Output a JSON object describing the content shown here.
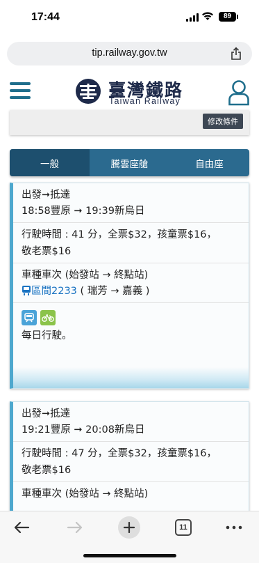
{
  "status": {
    "time": "17:44",
    "battery": "89"
  },
  "browser": {
    "url": "tip.railway.gov.tw",
    "tab_count": "11"
  },
  "header": {
    "title": "臺灣鐵路",
    "subtitle": "Taiwan Railway"
  },
  "condition": {
    "modify_label": "修改條件"
  },
  "tabs": [
    {
      "label": "一般",
      "active": true
    },
    {
      "label": "騰雲座艙",
      "active": false
    },
    {
      "label": "自由座",
      "active": false
    }
  ],
  "trains": [
    {
      "route_header": "出發➞抵達",
      "route": "18:58豐原 ➞ 19:39新烏日",
      "fare_line1": "行駛時間 : 41 分，全票$32，孩童票$16，",
      "fare_line2": "敬老票$16",
      "type_header": "車種車次 (始發站 → 終點站)",
      "train_no": "區間2233",
      "train_route": " ( 瑞芳 → 嘉義 )",
      "note": "每日行駛。"
    },
    {
      "route_header": "出發➞抵達",
      "route": "19:21豐原 ➞ 20:08新烏日",
      "fare_line1": "行駛時間 : 47 分，全票$32，孩童票$16，",
      "fare_line2": "敬老票$16",
      "type_header": "車種車次 (始發站 → 終點站)"
    }
  ],
  "colors": {
    "primary": "#2b6a8f",
    "tab_active": "#1d4f6e",
    "link": "#1a73c2",
    "accent": "#4ea8ce"
  }
}
